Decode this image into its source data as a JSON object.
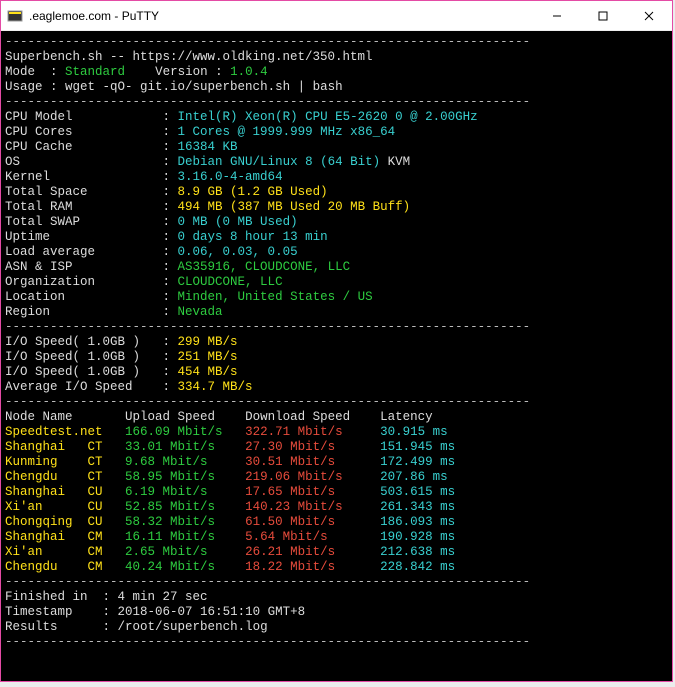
{
  "window": {
    "title": "        .eaglemoe.com - PuTTY"
  },
  "header": {
    "script_line": "Superbench.sh -- https://www.oldking.net/350.html",
    "mode_label": "Mode  :",
    "mode_value": "Standard",
    "version_label": "Version :",
    "version_value": "1.0.4",
    "usage_label": "Usage :",
    "usage_value": "wget -qO- git.io/superbench.sh | bash"
  },
  "sys": {
    "labels": {
      "cpu_model": "CPU Model",
      "cpu_cores": "CPU Cores",
      "cpu_cache": "CPU Cache",
      "os": "OS",
      "kernel": "Kernel",
      "total_space": "Total Space",
      "total_ram": "Total RAM",
      "total_swap": "Total SWAP",
      "uptime": "Uptime",
      "load": "Load average",
      "asn": "ASN & ISP",
      "org": "Organization",
      "loc": "Location",
      "region": "Region"
    },
    "values": {
      "cpu_model": "Intel(R) Xeon(R) CPU E5-2620 0 @ 2.00GHz",
      "cpu_cores": "1 Cores @ 1999.999 MHz x86_64",
      "cpu_cache": "16384 KB",
      "os": "Debian GNU/Linux 8 (64 Bit)",
      "os_suffix": " KVM",
      "kernel": "3.16.0-4-amd64",
      "total_space": "8.9 GB (1.2 GB Used)",
      "total_ram": "494 MB (387 MB Used 20 MB Buff)",
      "total_swap": "0 MB (0 MB Used)",
      "uptime": "0 days 8 hour 13 min",
      "load": "0.06, 0.03, 0.05",
      "asn": "AS35916, CLOUDCONE, LLC",
      "org": "CLOUDCONE, LLC",
      "loc": "Minden, United States / US",
      "region": "Nevada"
    }
  },
  "io": {
    "l1": "I/O Speed( 1.0GB )   :",
    "l2": "I/O Speed( 1.0GB )   :",
    "l3": "I/O Speed( 1.0GB )   :",
    "lavg": "Average I/O Speed    :",
    "v1": "299 MB/s",
    "v2": "251 MB/s",
    "v3": "454 MB/s",
    "vavg": "334.7 MB/s"
  },
  "net": {
    "h_node": "Node Name",
    "h_up": "Upload Speed",
    "h_down": "Download Speed",
    "h_lat": "Latency",
    "rows": [
      {
        "node": "Speedtest.net  ",
        "up": "166.09 Mbit/s   ",
        "down": "322.71 Mbit/s     ",
        "lat": "30.915 ms"
      },
      {
        "node": "Shanghai   CT  ",
        "up": "33.01 Mbit/s    ",
        "down": "27.30 Mbit/s      ",
        "lat": "151.945 ms"
      },
      {
        "node": "Kunming    CT  ",
        "up": "9.68 Mbit/s     ",
        "down": "30.51 Mbit/s      ",
        "lat": "172.499 ms"
      },
      {
        "node": "Chengdu    CT  ",
        "up": "58.95 Mbit/s    ",
        "down": "219.06 Mbit/s     ",
        "lat": "207.86 ms"
      },
      {
        "node": "Shanghai   CU  ",
        "up": "6.19 Mbit/s     ",
        "down": "17.65 Mbit/s      ",
        "lat": "503.615 ms"
      },
      {
        "node": "Xi'an      CU  ",
        "up": "52.85 Mbit/s    ",
        "down": "140.23 Mbit/s     ",
        "lat": "261.343 ms"
      },
      {
        "node": "Chongqing  CU  ",
        "up": "58.32 Mbit/s    ",
        "down": "61.50 Mbit/s      ",
        "lat": "186.093 ms"
      },
      {
        "node": "Shanghai   CM  ",
        "up": "16.11 Mbit/s    ",
        "down": "5.64 Mbit/s       ",
        "lat": "190.928 ms"
      },
      {
        "node": "Xi'an      CM  ",
        "up": "2.65 Mbit/s     ",
        "down": "26.21 Mbit/s      ",
        "lat": "212.638 ms"
      },
      {
        "node": "Chengdu    CM  ",
        "up": "40.24 Mbit/s    ",
        "down": "18.22 Mbit/s      ",
        "lat": "228.842 ms"
      }
    ]
  },
  "footer": {
    "fin_label": "Finished in  :",
    "fin_value": "4 min 27 sec",
    "ts_label": "Timestamp    :",
    "ts_value": "2018-06-07 16:51:10 GMT+8",
    "res_label": "Results      :",
    "res_value": "/root/superbench.log"
  },
  "rule": "----------------------------------------------------------------------"
}
